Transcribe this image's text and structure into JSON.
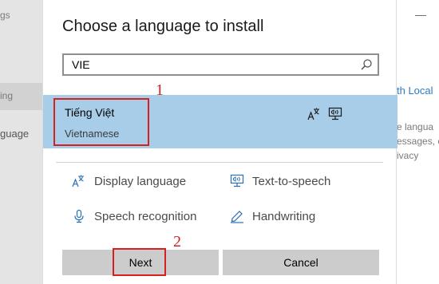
{
  "background": {
    "left_fragments": [
      "gs",
      "ing",
      "guage"
    ],
    "right_fragments": [
      "th Local",
      "e langua",
      "essages, e",
      "ivacy"
    ],
    "close_glyph": "—"
  },
  "dialog": {
    "title": "Choose a language to install",
    "search": {
      "value": "VIE",
      "icon": "search-icon"
    },
    "result": {
      "name": "Tiếng Việt",
      "subtitle": "Vietnamese",
      "icons": [
        "display-language-icon",
        "text-to-speech-icon"
      ]
    },
    "features": [
      {
        "label": "Display language",
        "icon": "display-language-icon"
      },
      {
        "label": "Text-to-speech",
        "icon": "text-to-speech-icon"
      },
      {
        "label": "Speech recognition",
        "icon": "microphone-icon"
      },
      {
        "label": "Handwriting",
        "icon": "handwriting-icon"
      }
    ],
    "buttons": {
      "next": "Next",
      "cancel": "Cancel"
    }
  },
  "annotations": {
    "step1": "1",
    "step2": "2",
    "color": "#d62020"
  },
  "colors": {
    "selection": "#a8cde9",
    "button": "#cccccc",
    "icon": "#2a6fb5"
  }
}
